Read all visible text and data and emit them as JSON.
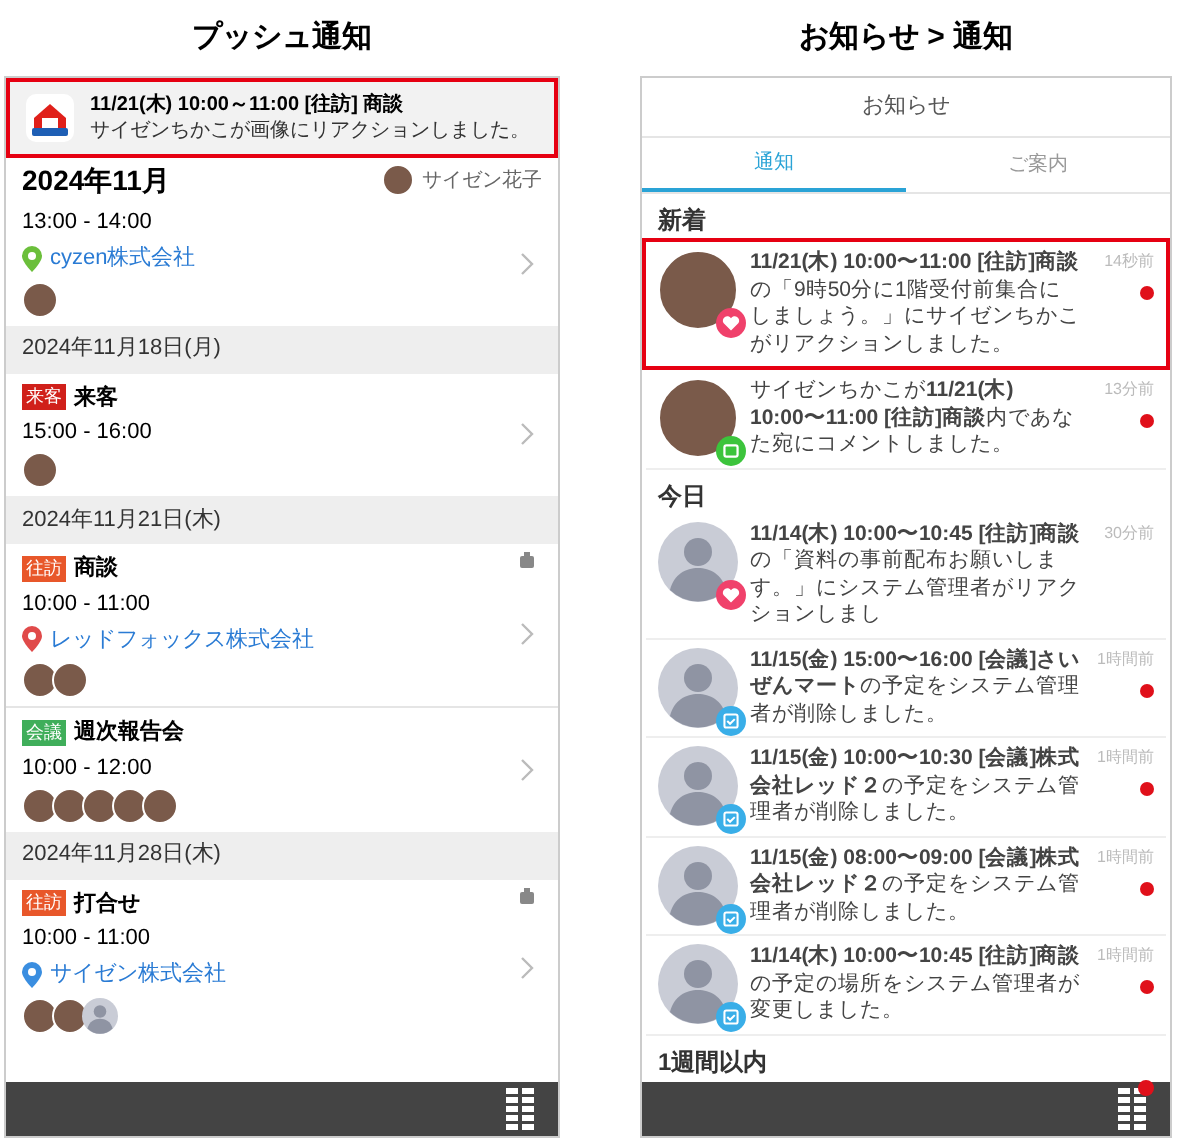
{
  "left": {
    "title": "プッシュ通知",
    "banner": {
      "highlighted": true,
      "title": "11/21(木) 10:00～11:00 [往訪] 商談",
      "body": "サイゼンちかこが画像にリアクションしました。"
    },
    "header": {
      "month": "2024年11月",
      "user": "サイゼン花子"
    },
    "groups": [
      {
        "events": [
          {
            "time": "13:00 - 14:00",
            "company": {
              "name": "cyzen株式会社",
              "color": "#6bbf3b"
            },
            "locked": false,
            "avatars": [
              {
                "kind": "photo"
              }
            ]
          }
        ]
      },
      {
        "date": "2024年11月18日(月)",
        "events": [
          {
            "tag": "来客",
            "color": "#d0201a",
            "title": "来客",
            "time": "15:00 - 16:00",
            "locked": false,
            "avatars": [
              {
                "kind": "photo"
              }
            ]
          }
        ]
      },
      {
        "date": "2024年11月21日(木)",
        "events": [
          {
            "tag": "往訪",
            "color": "#e8572a",
            "title": "商談",
            "time": "10:00 - 11:00",
            "company": {
              "name": "レッドフォックス株式会社",
              "color": "#e04a4a"
            },
            "locked": true,
            "avatars": [
              {
                "kind": "photo"
              },
              {
                "kind": "photo"
              }
            ]
          },
          {
            "tag": "会議",
            "color": "#3fae5a",
            "title": "週次報告会",
            "time": "10:00 - 12:00",
            "locked": false,
            "avatars": [
              {
                "kind": "photo"
              },
              {
                "kind": "photo"
              },
              {
                "kind": "photo"
              },
              {
                "kind": "photo"
              },
              {
                "kind": "photo"
              }
            ]
          }
        ]
      },
      {
        "date": "2024年11月28日(木)",
        "events": [
          {
            "tag": "往訪",
            "color": "#e8572a",
            "title": "打合せ",
            "time": "10:00 - 11:00",
            "company": {
              "name": "サイゼン株式会社",
              "color": "#3a8ee0"
            },
            "locked": true,
            "avatars": [
              {
                "kind": "photo"
              },
              {
                "kind": "photo"
              },
              {
                "kind": "silhouette"
              }
            ]
          }
        ]
      }
    ]
  },
  "right": {
    "title": "お知らせ > 通知",
    "header": "お知らせ",
    "tabs": [
      {
        "label": "通知",
        "selected": true
      },
      {
        "label": "ご案内",
        "selected": false
      }
    ],
    "sections": [
      {
        "heading": "新着",
        "items": [
          {
            "avatar": {
              "kind": "photo"
            },
            "badge": {
              "kind": "heart"
            },
            "highlighted": true,
            "unread": true,
            "time": "14秒前",
            "text": "**11/21(木) 10:00〜11:00 [往訪]商談**の「9時50分に1階受付前集合にしましょう。」にサイゼンちかこがリアクションしました。"
          },
          {
            "avatar": {
              "kind": "photo"
            },
            "badge": {
              "kind": "comment"
            },
            "highlighted": false,
            "unread": true,
            "time": "13分前",
            "text": "サイゼンちかこが**11/21(木) 10:00〜11:00 [往訪]商談**内であなた宛にコメントしました。"
          }
        ]
      },
      {
        "heading": "今日",
        "items": [
          {
            "avatar": {
              "kind": "silhouette"
            },
            "badge": {
              "kind": "heart"
            },
            "highlighted": false,
            "unread": false,
            "time": "30分前",
            "text": "**11/14(木) 10:00〜10:45 [往訪]商談**の「資料の事前配布お願いします。」にシステム管理者がリアクションしまし"
          },
          {
            "avatar": {
              "kind": "silhouette"
            },
            "badge": {
              "kind": "calendar"
            },
            "highlighted": false,
            "unread": true,
            "time": "1時間前",
            "text": "**11/15(金) 15:00〜16:00 [会議]さいぜんマート**の予定をシステム管理者が削除しました。"
          },
          {
            "avatar": {
              "kind": "silhouette"
            },
            "badge": {
              "kind": "calendar"
            },
            "highlighted": false,
            "unread": true,
            "time": "1時間前",
            "text": "**11/15(金) 10:00〜10:30 [会議]株式会社レッド２**の予定をシステム管理者が削除しました。"
          },
          {
            "avatar": {
              "kind": "silhouette"
            },
            "badge": {
              "kind": "calendar"
            },
            "highlighted": false,
            "unread": true,
            "time": "1時間前",
            "text": "**11/15(金) 08:00〜09:00 [会議]株式会社レッド２**の予定をシステム管理者が削除しました。"
          },
          {
            "avatar": {
              "kind": "silhouette"
            },
            "badge": {
              "kind": "calendar"
            },
            "highlighted": false,
            "unread": true,
            "time": "1時間前",
            "text": "**11/14(木) 10:00〜10:45 [往訪]商談**の予定の場所をシステム管理者が変更しました。"
          }
        ]
      },
      {
        "heading": "1週間以内"
      }
    ],
    "menu_badge": true
  }
}
